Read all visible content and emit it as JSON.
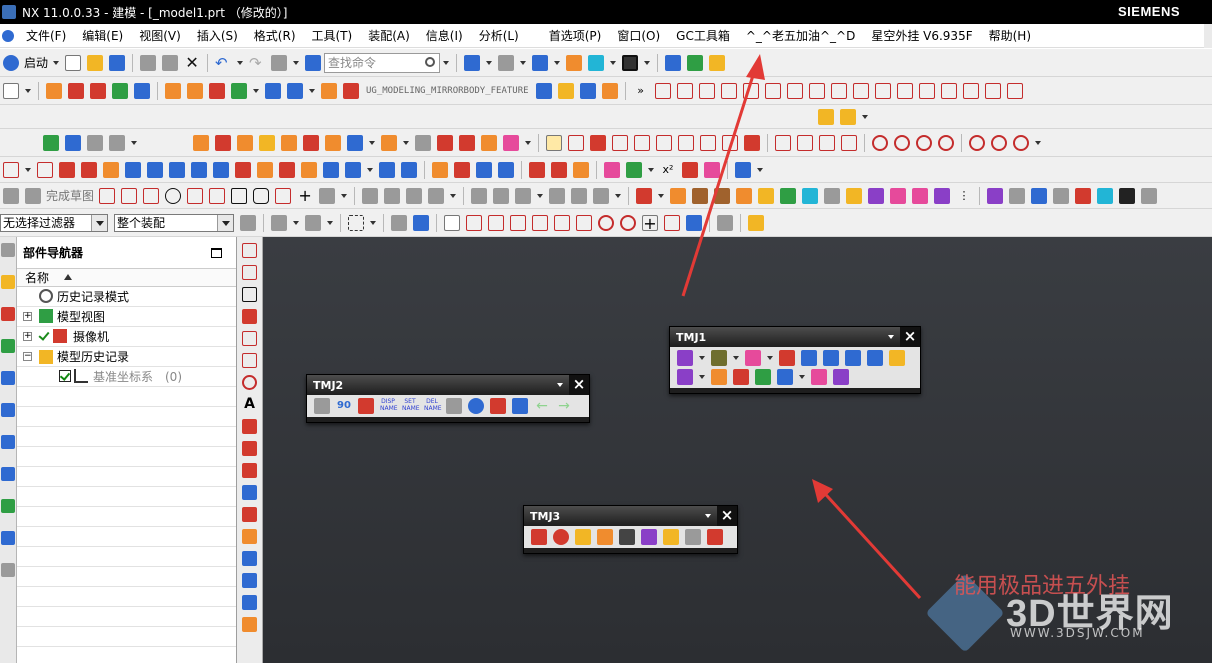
{
  "window": {
    "title": "NX 11.0.0.33 - 建模 - [_model1.prt （修改的）]",
    "brand": "SIEMENS"
  },
  "menu": [
    "文件(F)",
    "编辑(E)",
    "视图(V)",
    "插入(S)",
    "格式(R)",
    "工具(T)",
    "装配(A)",
    "信息(I)",
    "分析(L)",
    "首选项(P)",
    "窗口(O)",
    "GC工具箱",
    "^_^老五加油^_^D",
    "星空外挂 V6.935F",
    "帮助(H)"
  ],
  "toolbar": {
    "start_label": "启动",
    "search_placeholder": "查找命令",
    "feature_label": "UG_MODELING_MIRRORBODY_FEATURE",
    "finish_sketch_label": "完成草图"
  },
  "selection": {
    "filter_value": "无选择过滤器",
    "scope_value": "整个装配"
  },
  "navigator": {
    "title": "部件导航器",
    "column_header": "名称",
    "rows": [
      {
        "label": "历史记录模式"
      },
      {
        "label": "模型视图"
      },
      {
        "label": "摄像机"
      },
      {
        "label": "模型历史记录"
      },
      {
        "label": "基准坐标系",
        "count": "(0)"
      }
    ]
  },
  "floating_toolbars": [
    {
      "title": "TMJ1"
    },
    {
      "title": "TMJ2",
      "text_buttons": [
        "90",
        "DISP NAME",
        "SET NAME",
        "DEL NAME"
      ]
    },
    {
      "title": "TMJ3"
    }
  ],
  "watermark": {
    "slogan": "能用极品进五外挂",
    "brand": "3D世界网",
    "url": "WWW.3DSJW.COM"
  }
}
